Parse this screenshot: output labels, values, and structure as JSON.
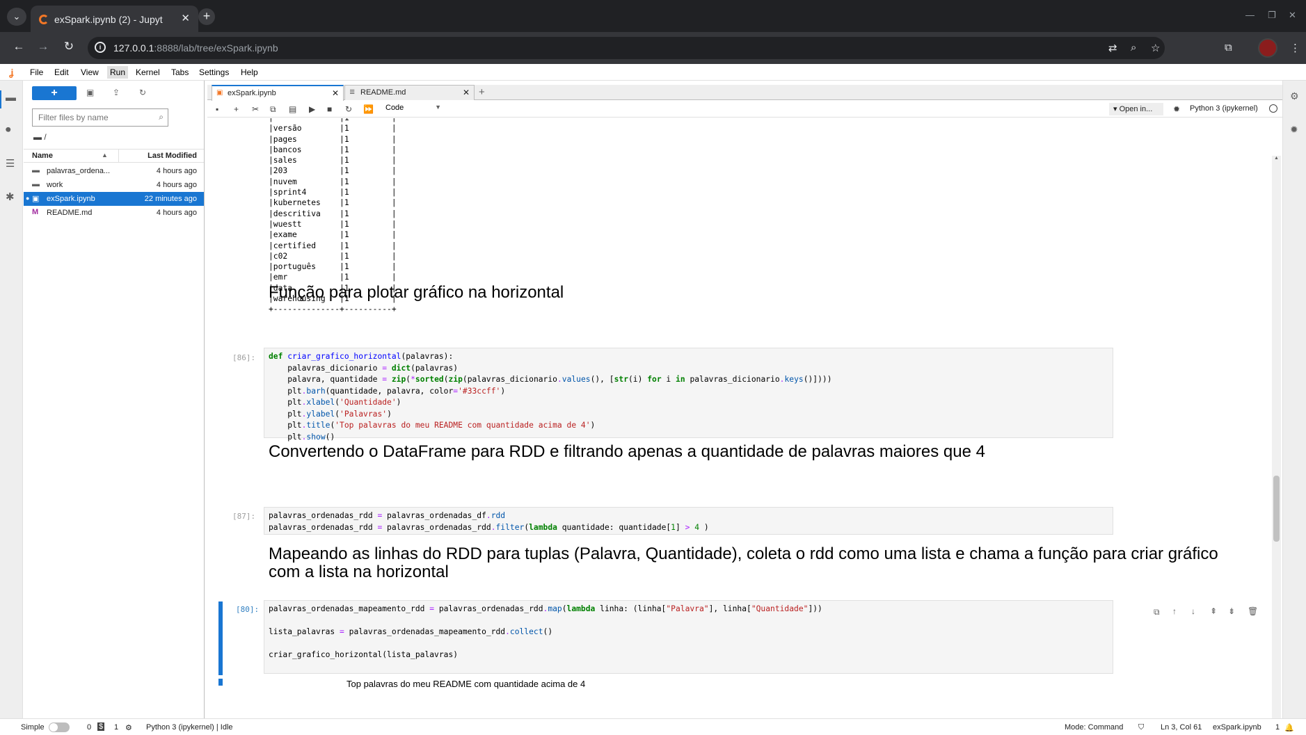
{
  "browser": {
    "tab_title": "exSpark.ipynb (2) - Jupyt",
    "url_host": "127.0.0.1",
    "url_rest": ":8888/lab/tree/exSpark.ipynb"
  },
  "menu": [
    "File",
    "Edit",
    "View",
    "Run",
    "Kernel",
    "Tabs",
    "Settings",
    "Help"
  ],
  "filebrowser": {
    "new_label": "+",
    "filter_placeholder": "Filter files by name",
    "breadcrumb": "/",
    "col_name": "Name",
    "col_modified": "Last Modified",
    "files": [
      {
        "name": "palavras_ordena...",
        "modified": "4 hours ago",
        "icon": "folder-icon"
      },
      {
        "name": "work",
        "modified": "4 hours ago",
        "icon": "folder-icon"
      },
      {
        "name": "exSpark.ipynb",
        "modified": "22 minutes ago",
        "icon": "notebook-icon",
        "selected": true
      },
      {
        "name": "README.md",
        "modified": "4 hours ago",
        "icon": "markdown-icon"
      }
    ]
  },
  "doc_tabs": [
    {
      "label": "exSpark.ipynb"
    },
    {
      "label": "README.md"
    }
  ],
  "toolbar": {
    "cell_type": "Code",
    "open_in": "Open in...",
    "kernel": "Python 3 (ipykernel)"
  },
  "output_table": "|·····         |1         |\n|versão        |1         |\n|pages         |1         |\n|bancos        |1         |\n|sales         |1         |\n|203           |1         |\n|nuvem         |1         |\n|sprint4       |1         |\n|kubernetes    |1         |\n|descritiva    |1         |\n|wuestt        |1         |\n|exame         |1         |\n|certified     |1         |\n|c02           |1         |\n|português     |1         |\n|emr           |1         |\n|data          |1         |\n|warehousing   |1         |\n+--------------+----------+",
  "cells": {
    "h1": "Função para plotar gráfico na horizontal",
    "p86": "[86]:",
    "h2": "Convertendo o DataFrame para RDD e filtrando apenas a quantidade de palavras maiores que 4",
    "p87": "[87]:",
    "h3": "Mapeando as linhas do RDD para tuplas (Palavra, Quantidade), coleta o rdd como uma lista e chama a função para criar gráfico com a lista na horizontal",
    "p80": "[80]:",
    "trailing_output": "Top palavras do meu README com quantidade acima de 4"
  },
  "status": {
    "mode_label": "Simple",
    "count1": "0",
    "count2": "1",
    "kernel_status": "Python 3 (ipykernel) | Idle",
    "mode": "Mode: Command",
    "position": "Ln 3, Col 61",
    "file": "exSpark.ipynb",
    "notif": "1"
  },
  "colors": {
    "accent": "#1976d2",
    "jupyter_orange": "#f37726"
  }
}
